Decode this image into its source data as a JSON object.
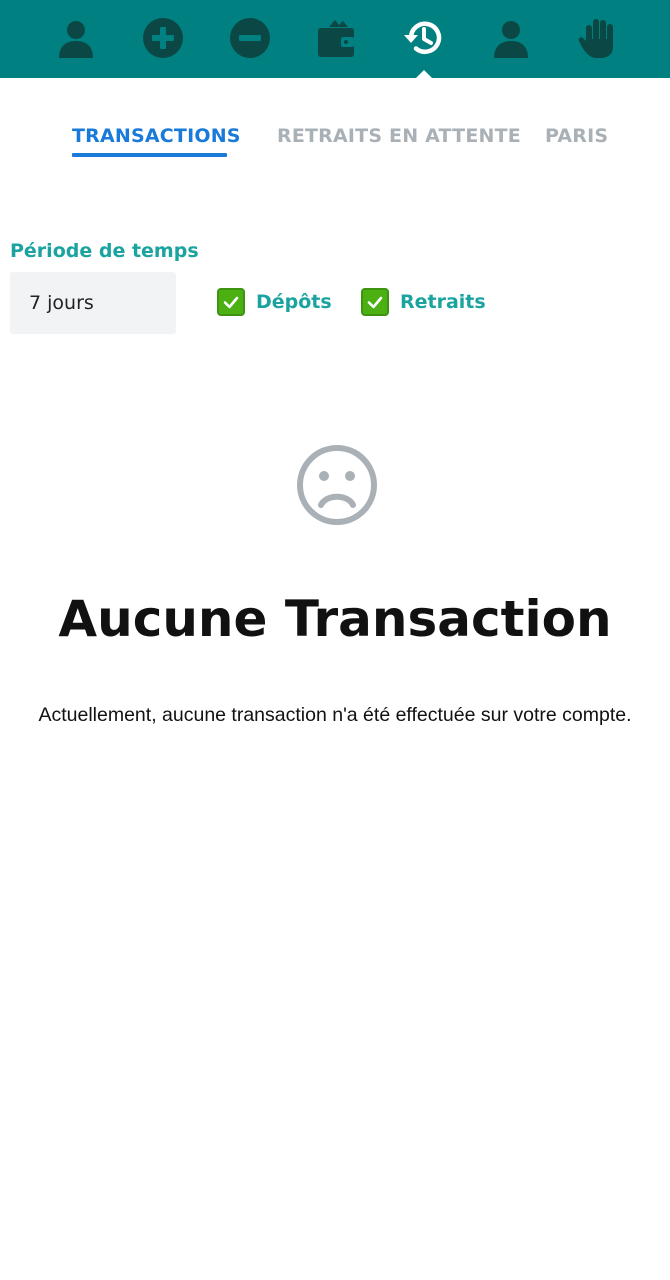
{
  "nav": {
    "icons": [
      "user-icon",
      "plus-circle-icon",
      "minus-circle-icon",
      "wallet-icon",
      "history-icon",
      "profile-icon",
      "hand-icon"
    ],
    "active": "history-icon"
  },
  "tabs": [
    {
      "label": "TRANSACTIONS",
      "active": true
    },
    {
      "label": "RETRAITS EN ATTENTE",
      "active": false
    },
    {
      "label": "PARIS",
      "active": false
    }
  ],
  "filters": {
    "period_label": "Période de temps",
    "period_value": "7 jours",
    "deposits_label": "Dépôts",
    "deposits_checked": true,
    "withdrawals_label": "Retraits",
    "withdrawals_checked": true
  },
  "empty_state": {
    "icon": "sad-face-icon",
    "title": "Aucune Transaction",
    "message": "Actuellement, aucune transaction n'a été effectuée sur votre compte."
  },
  "colors": {
    "topbar": "#008080",
    "icon_dark": "#0b4744",
    "tab_active": "#1a7ad9",
    "tab_inactive": "#a9b0b6",
    "label_teal": "#1aa39f",
    "checkbox_green": "#4caf12"
  }
}
